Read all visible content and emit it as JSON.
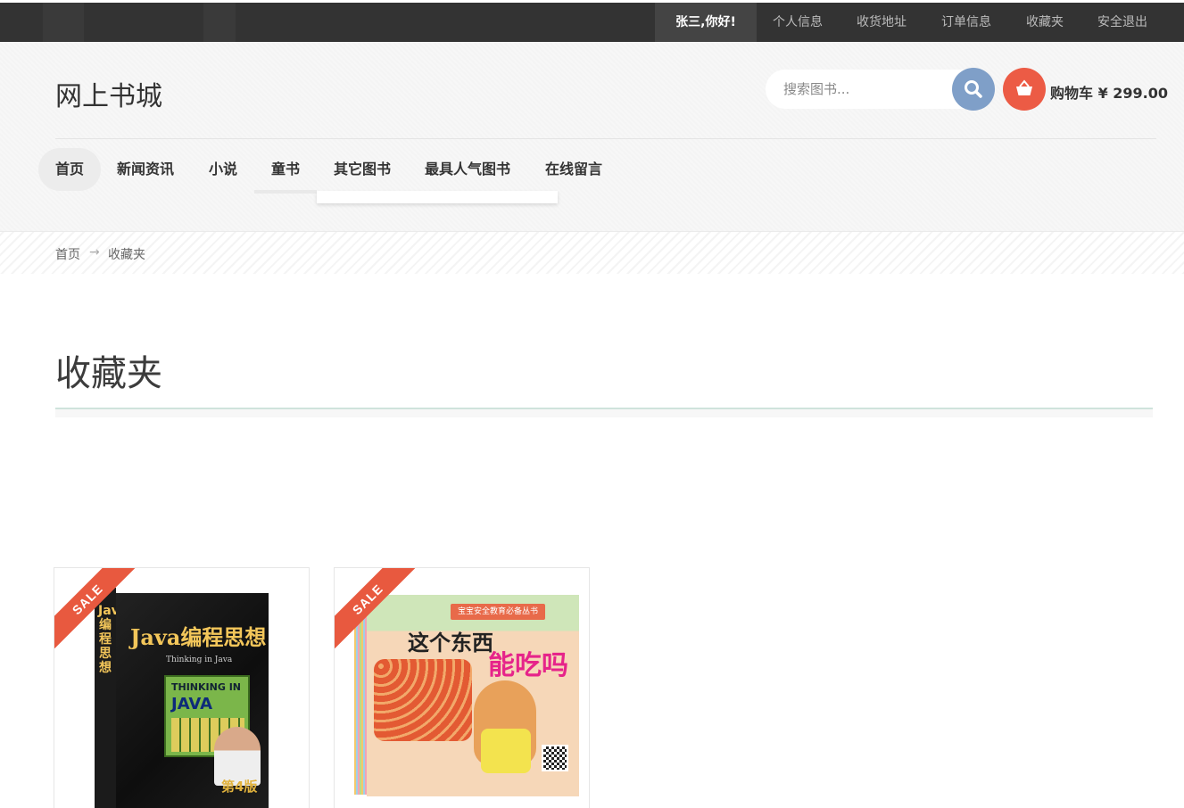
{
  "topbar": {
    "greeting": "张三,你好!",
    "links": [
      "个人信息",
      "收货地址",
      "订单信息",
      "收藏夹",
      "安全退出"
    ]
  },
  "header": {
    "logo": "网上书城",
    "search_placeholder": "搜索图书...",
    "cart_label": "购物车 ¥ 299.00",
    "nav": [
      "首页",
      "新闻资讯",
      "小说",
      "童书",
      "其它图书",
      "最具人气图书",
      "在线留言"
    ],
    "active_nav": "首页"
  },
  "breadcrumb": {
    "home": "首页",
    "separator": "→",
    "current": "收藏夹"
  },
  "page": {
    "title": "收藏夹"
  },
  "products": [
    {
      "badge": "SALE",
      "cover": {
        "title": "Java编程思想",
        "subtitle": "Thinking in Java",
        "grid_label": "THINKING IN",
        "grid_word": "JAVA",
        "edition": "第4版",
        "spine": "Java编程思想"
      }
    },
    {
      "badge": "SALE",
      "cover": {
        "banner": "宝宝安全教育必备丛书",
        "title_line1": "这个东西",
        "title_line2": "能吃吗"
      }
    }
  ],
  "colors": {
    "topbar": "#333333",
    "search_button": "#7f9fc8",
    "cart_button": "#ec5b45",
    "sale_ribbon": "#e8593f"
  },
  "icons": {
    "search": "search-icon",
    "cart": "basket-icon"
  }
}
